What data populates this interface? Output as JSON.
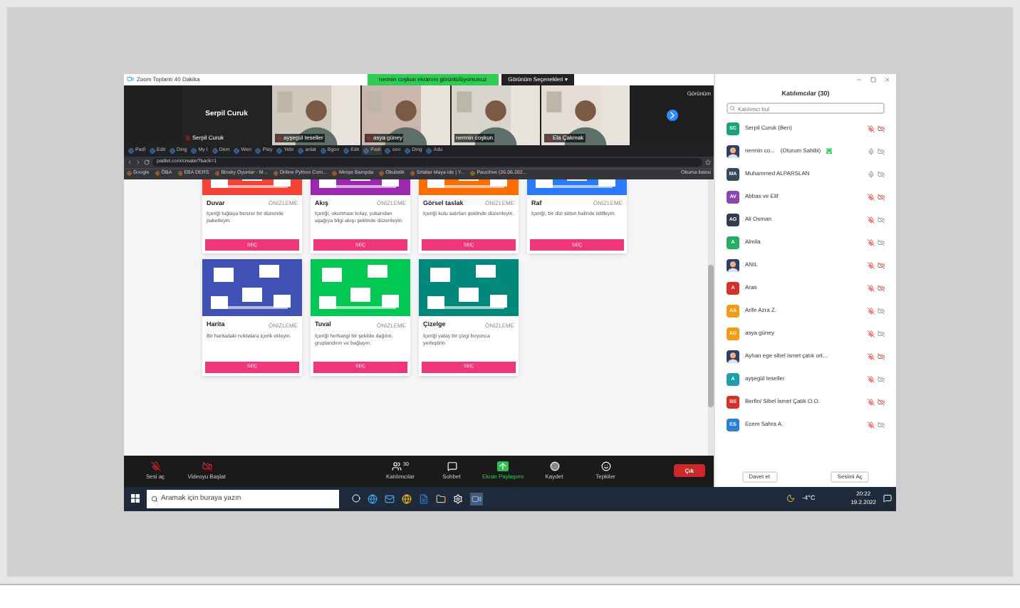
{
  "zoom_window": {
    "title": "Zoom Toplantı 40 Dakika",
    "share_banner": "nermin coşkun ekranını görüntülüyorsunuz",
    "view_options": "Görünüm Seçenekleri ▾",
    "view_label": "Görünüm"
  },
  "speaker_tile": {
    "name": "Serpil Curuk",
    "label": "Serpil Curuk"
  },
  "video_tiles": [
    {
      "name": "ayşegül teseller",
      "muted": true
    },
    {
      "name": "asya güney",
      "muted": true
    },
    {
      "name": "nermin coşkun",
      "muted": false
    },
    {
      "name": "Ela Çakmak",
      "muted": true
    }
  ],
  "browser": {
    "tabs": [
      {
        "label": "Padl",
        "selected": false
      },
      {
        "label": "Edit",
        "selected": false
      },
      {
        "label": "Ding",
        "selected": false
      },
      {
        "label": "My I",
        "selected": false
      },
      {
        "label": "Dem",
        "selected": false
      },
      {
        "label": "Wen",
        "selected": false
      },
      {
        "label": "Play",
        "selected": false
      },
      {
        "label": "Yebr",
        "selected": false
      },
      {
        "label": "anlat",
        "selected": false
      },
      {
        "label": "Bgoo",
        "selected": false
      },
      {
        "label": "Edit",
        "selected": false
      },
      {
        "label": "Padı",
        "selected": true
      },
      {
        "label": "ooo",
        "selected": false
      },
      {
        "label": "Ding",
        "selected": false
      },
      {
        "label": "Adu",
        "selected": false
      }
    ],
    "address": "padlet.com/create/?back=1",
    "bookmarks": [
      "Google",
      "ÖBA",
      "EBA DERS",
      "Bloxky Oyunlar - M...",
      "Online Python Com...",
      "Minişe Bampda",
      "Okulistik",
      "Sıfatlar Maya ide | Y...",
      "Paucihve (26.06.202..."
    ],
    "reading_list": "Okuma listesi"
  },
  "cards": [
    {
      "title": "Duvar",
      "preview": "ÖNİZLEME",
      "description": "İçeriği tuğlaya benzer bir düzende paketleyin.",
      "button": "SEÇ",
      "color": "#f44336"
    },
    {
      "title": "Akış",
      "preview": "ÖNİZLEME",
      "description": "İçeriği, okunması kolay, yukarıdan aşağıya bilgi akışı şeklinde düzenleyin.",
      "button": "SEÇ",
      "color": "#9c27b0"
    },
    {
      "title": "Görsel taslak",
      "preview": "ÖNİZLEME",
      "description": "İçeriği kutu satırları şeklinde düzenleyin.",
      "button": "SEÇ",
      "color": "#ff6d00"
    },
    {
      "title": "Raf",
      "preview": "ÖNİZLEME",
      "description": "İçeriği, bir dizi sütun halinde istifleyin.",
      "button": "SEÇ",
      "color": "#2979ff"
    },
    {
      "title": "Harita",
      "preview": "ÖNİZLEME",
      "description": "Bir haritadaki noktalara içerik ekleyin.",
      "button": "SEÇ",
      "color": "#3f51b5"
    },
    {
      "title": "Tuval",
      "preview": "ÖNİZLEME",
      "description": "İçeriği herhangi bir şekilde dağıtın, gruplandırın ve bağlayın.",
      "button": "SEÇ",
      "color": "#00c853"
    },
    {
      "title": "Çizelge",
      "preview": "ÖNİZLEME",
      "description": "İçeriği yatay bir çizgi boyunca yerleştirin.",
      "button": "SEÇ",
      "color": "#00897b"
    }
  ],
  "toolbar": {
    "items": [
      {
        "kind": "mic",
        "label": "Sesi aç"
      },
      {
        "kind": "video",
        "label": "Videoyu Başlat"
      },
      {
        "kind": "participants",
        "label": "Katılımcılar",
        "count": "30"
      },
      {
        "kind": "chat",
        "label": "Sohbet"
      },
      {
        "kind": "share",
        "label": "Ekran Paylaşımı"
      },
      {
        "kind": "record",
        "label": "Kaydet"
      },
      {
        "kind": "reactions",
        "label": "Tepkiler"
      }
    ],
    "leave": "Çık"
  },
  "participants_panel": {
    "title": "Katılımcılar (30)",
    "search": {
      "placeholder": "Katılımcı bul"
    },
    "people": [
      {
        "initials": "SC",
        "name": "Serpil Curuk (Ben)",
        "color": "#1aa37a",
        "mic_muted": true,
        "cam_red": true
      },
      {
        "kind": "picture",
        "name": "nermin co...",
        "role": "(Oturum Sahibi)",
        "mic_muted": false,
        "cam_red": false
      },
      {
        "initials": "MA",
        "name": "Muhammed ALPARSLAN",
        "color": "#34495e",
        "mic_muted": false,
        "cam_red": false
      },
      {
        "initials": "AV",
        "name": "Abbas ve Elif",
        "color": "#8e44ad",
        "mic_muted": true,
        "cam_red": true
      },
      {
        "initials": "AO",
        "name": "Ali Osman",
        "color": "#2c3e50",
        "mic_muted": true,
        "cam_red": false
      },
      {
        "initials": "A",
        "name": "Almila",
        "color": "#27ae60",
        "mic_muted": true,
        "cam_red": false
      },
      {
        "kind": "picture",
        "name": "ANIL",
        "mic_muted": true,
        "cam_red": true
      },
      {
        "initials": "A",
        "name": "Aras",
        "color": "#d93025",
        "mic_muted": true,
        "cam_red": true
      },
      {
        "initials": "AA",
        "name": "Arife Azra Z.",
        "color": "#f39c12",
        "mic_muted": true,
        "cam_red": false
      },
      {
        "initials": "AG",
        "name": "asya güney",
        "color": "#f39c12",
        "mic_muted": true,
        "cam_red": false
      },
      {
        "kind": "picture",
        "name": "Ayhan ege sibel ismet çatık ort...",
        "mic_muted": true,
        "cam_red": true
      },
      {
        "initials": "A",
        "name": "ayşegül teseller",
        "color": "#1e9fb0",
        "mic_muted": true,
        "cam_red": false
      },
      {
        "initials": "BS",
        "name": "Berfin/ Sibel İsmet Çatık O.O.",
        "color": "#d93025",
        "mic_muted": true,
        "cam_red": true
      },
      {
        "initials": "ES",
        "name": "Ecem Sahra A.",
        "color": "#2d7fd3",
        "mic_muted": true,
        "cam_red": false
      }
    ],
    "buttons": [
      "Davet et",
      "Sesimi Aç"
    ]
  },
  "taskbar": {
    "search": {
      "placeholder": "Aramak için buraya yazın"
    },
    "temperature": "-4°C",
    "time": "20:22",
    "date": "19.2.2022"
  }
}
